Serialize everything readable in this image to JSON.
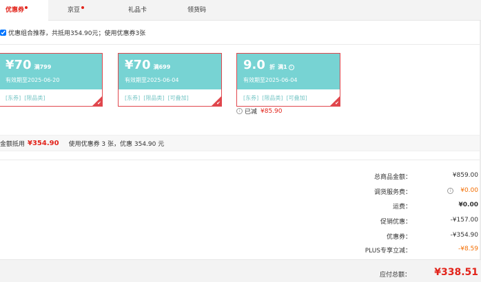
{
  "tabs": [
    {
      "label": "优惠券",
      "active": true,
      "dot": true
    },
    {
      "label": "京豆",
      "active": false,
      "dot": true
    },
    {
      "label": "礼品卡",
      "active": false,
      "dot": false
    },
    {
      "label": "领货码",
      "active": false,
      "dot": false
    }
  ],
  "recommend": {
    "text": "优惠组合推荐，共抵用354.90元；使用优惠券3张",
    "checked": true
  },
  "coupons": [
    {
      "amount": "¥70",
      "unit": "",
      "condition": "满799",
      "validity": "有效期至2025-06-20",
      "tags": [
        "[东券]",
        "[限品类]"
      ],
      "selected": true,
      "has_info": false
    },
    {
      "amount": "¥70",
      "unit": "",
      "condition": "满699",
      "validity": "有效期至2025-06-04",
      "tags": [
        "[东券]",
        "[限品类]",
        "[可叠加]"
      ],
      "selected": true,
      "has_info": false
    },
    {
      "amount": "9.0",
      "unit": "折",
      "condition": "满1",
      "validity": "有效期至2025-06-04",
      "tags": [
        "[东券]",
        "[限品类]",
        "[可叠加]"
      ],
      "selected": true,
      "has_info": true
    }
  ],
  "saved": {
    "label": "已减",
    "amount": "¥85.90"
  },
  "summary": {
    "label": "金额抵用",
    "amount": "¥354.90",
    "desc": "使用优惠券 3 张，优惠 354.90 元"
  },
  "price_rows": [
    {
      "label": "总商品金额：",
      "value": "¥859.00",
      "style": "normal",
      "info": false
    },
    {
      "label": "调货服务费：",
      "value": "¥0.00",
      "style": "orange",
      "info": true
    },
    {
      "label": "运费：",
      "value": "¥0.00",
      "style": "bold",
      "info": false
    },
    {
      "label": "促销优惠：",
      "value": "-¥157.00",
      "style": "normal",
      "info": false
    },
    {
      "label": "优惠券：",
      "value": "-¥354.90",
      "style": "normal",
      "info": false
    },
    {
      "label": "PLUS专享立减：",
      "value": "-¥8.59",
      "style": "orange",
      "info": false
    }
  ],
  "total": {
    "label": "应付总额：",
    "value": "¥338.51"
  },
  "colors": {
    "accent": "#e2231a",
    "coupon_bg": "#77d3d3",
    "coupon_border": "#e0464c",
    "orange": "#f36d00"
  }
}
